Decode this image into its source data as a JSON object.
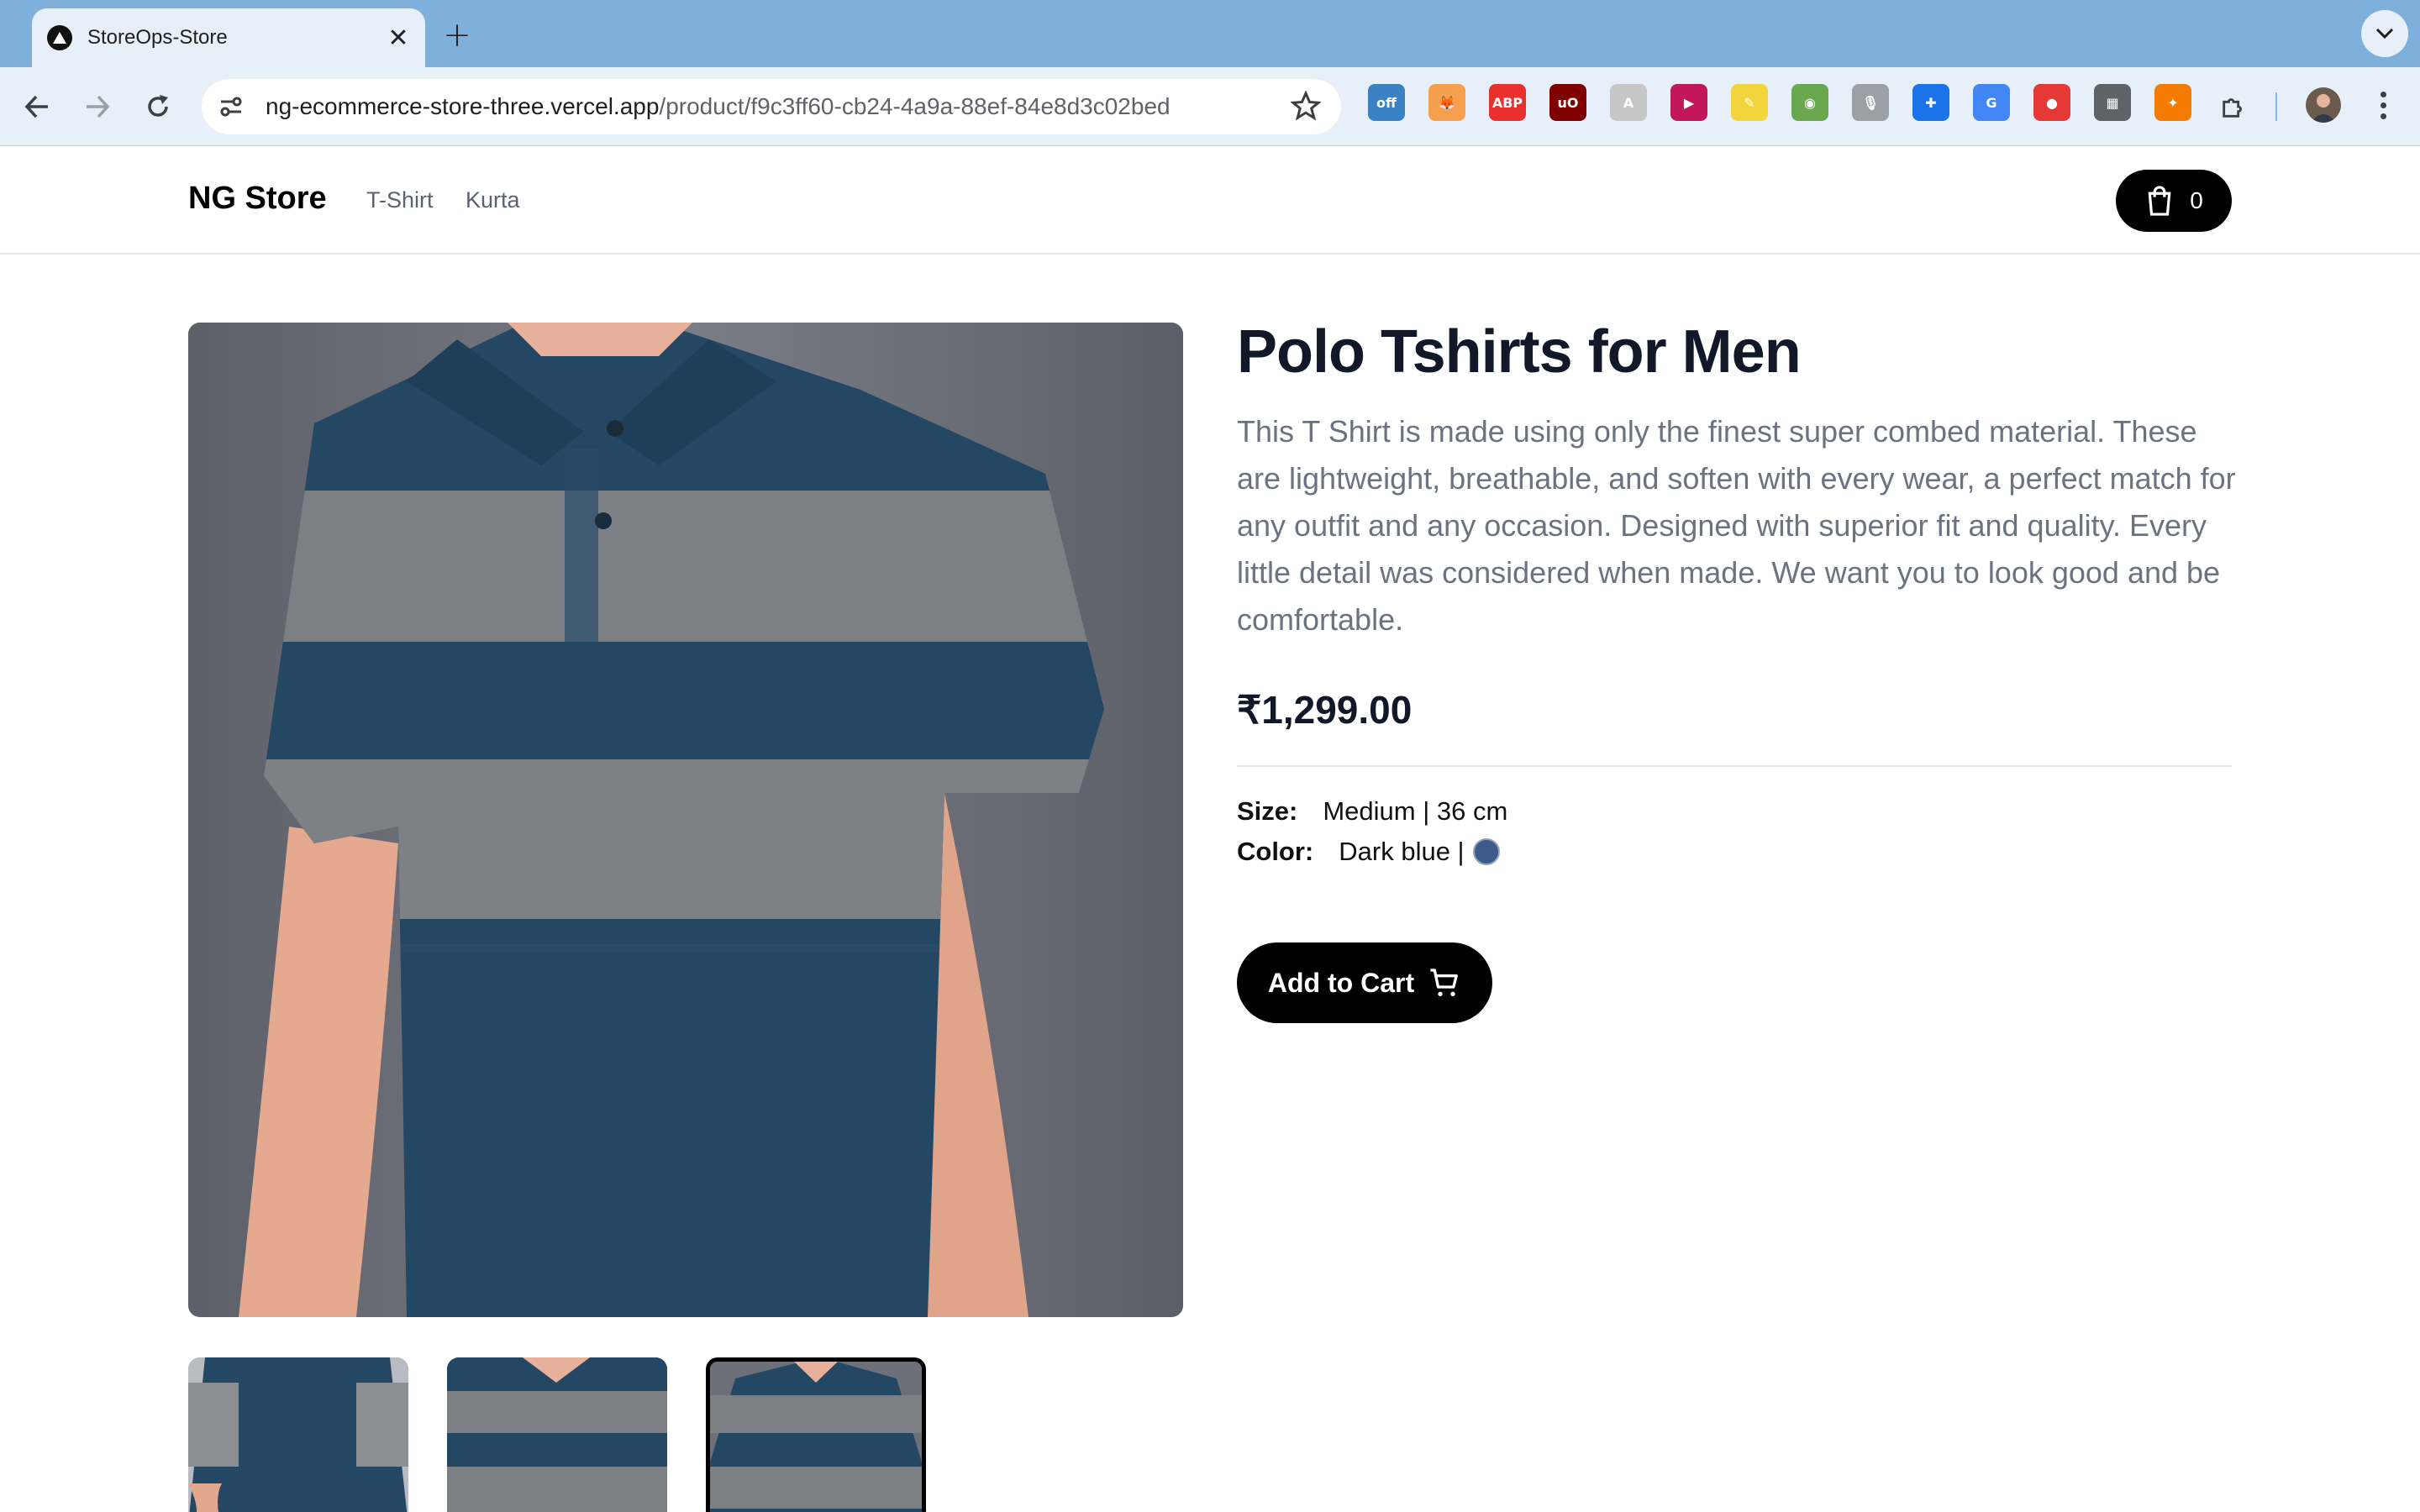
{
  "browser": {
    "tab_title": "StoreOps-Store",
    "tab_close": "✕",
    "new_tab": "+",
    "url_host": "ng-ecommerce-store-three.vercel.app",
    "url_path": "/product/f9c3ff60-cb24-4a9a-88ef-84e8d3c02bed",
    "extensions": [
      {
        "name": "honey-off-extension",
        "label": "off",
        "color": "#3b82c4"
      },
      {
        "name": "metamask-extension",
        "label": "🦊",
        "color": "#f6a04d"
      },
      {
        "name": "adblock-plus-extension",
        "label": "ABP",
        "color": "#e8312f"
      },
      {
        "name": "ublock-origin-extension",
        "label": "uO",
        "color": "#800000"
      },
      {
        "name": "generic-extension-1",
        "label": "A",
        "color": "#c7c7c7"
      },
      {
        "name": "video-extension",
        "label": "▶",
        "color": "#c2185b"
      },
      {
        "name": "highlighter-extension",
        "label": "✎",
        "color": "#f2d53c"
      },
      {
        "name": "color-picker-extension",
        "label": "◉",
        "color": "#6aa84f"
      },
      {
        "name": "microphone-extension",
        "label": "🎙",
        "color": "#9aa0a6"
      },
      {
        "name": "cross-extension",
        "label": "✚",
        "color": "#1a73e8"
      },
      {
        "name": "google-translate-extension",
        "label": "G",
        "color": "#4285f4"
      },
      {
        "name": "screen-recorder-extension",
        "label": "●",
        "color": "#e53935"
      },
      {
        "name": "qr-code-extension",
        "label": "▦",
        "color": "#5f6368"
      },
      {
        "name": "orange-extension",
        "label": "✦",
        "color": "#f57c00"
      }
    ]
  },
  "site": {
    "logo": "NG Store",
    "nav": [
      "T-Shirt",
      "Kurta"
    ],
    "cart_count": "0"
  },
  "product": {
    "title": "Polo Tshirts for Men",
    "description": "This T Shirt is made using only the finest super combed material. These are lightweight, breathable, and soften with every wear, a perfect match for any outfit and any occasion. Designed with superior fit and quality. Every little detail was considered when made. We want you to look good and be comfortable.",
    "price": "₹1,299.00",
    "size_label": "Size:",
    "size_value": "Medium | 36 cm",
    "color_label": "Color:",
    "color_value": "Dark blue |",
    "color_swatch": "#3e5a8a",
    "add_to_cart_label": "Add to Cart",
    "selected_thumbnail": 3
  },
  "colors": {
    "shirt_navy": "#244763",
    "shirt_grey": "#7b7f84",
    "background_grey": "#6d7079",
    "skin": "#e9b9a0"
  }
}
